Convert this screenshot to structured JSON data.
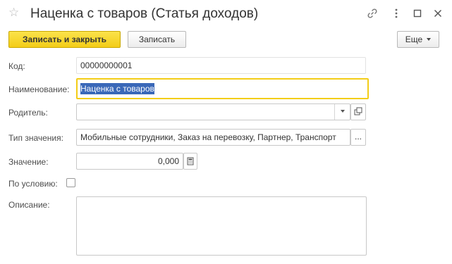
{
  "window": {
    "title": "Наценка с товаров (Статья доходов)"
  },
  "toolbar": {
    "save_close_label": "Записать и закрыть",
    "save_label": "Записать",
    "more_label": "Еще"
  },
  "form": {
    "code": {
      "label": "Код:",
      "value": "00000000001"
    },
    "name": {
      "label": "Наименование:",
      "value": "Наценка с товаров"
    },
    "parent": {
      "label": "Родитель:",
      "value": ""
    },
    "value_type": {
      "label": "Тип значения:",
      "value": "Мобильные сотрудники, Заказ на перевозку, Партнер, Транспорт"
    },
    "value": {
      "label": "Значение:",
      "value": "0,000"
    },
    "by_condition": {
      "label": "По условию:",
      "checked": false
    },
    "description": {
      "label": "Описание:",
      "value": ""
    }
  },
  "icons": {
    "favorite": "star-icon",
    "link": "link-icon",
    "more": "kebab-icon",
    "maximize": "maximize-icon",
    "close": "close-icon",
    "dropdown": "chevron-down-icon",
    "open": "open-icon",
    "select": "ellipsis-icon",
    "calculator": "calculator-icon"
  }
}
